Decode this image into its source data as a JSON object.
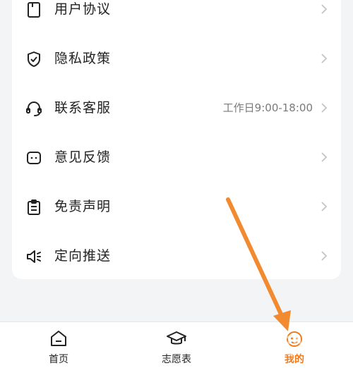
{
  "menu": {
    "items": [
      {
        "label": "用户协议",
        "icon": "document-icon",
        "extra": ""
      },
      {
        "label": "隐私政策",
        "icon": "shield-check-icon",
        "extra": ""
      },
      {
        "label": "联系客服",
        "icon": "headset-icon",
        "extra": "工作日9:00-18:00"
      },
      {
        "label": "意见反馈",
        "icon": "feedback-face-icon",
        "extra": ""
      },
      {
        "label": "免责声明",
        "icon": "clipboard-icon",
        "extra": ""
      },
      {
        "label": "定向推送",
        "icon": "speaker-icon",
        "extra": ""
      }
    ]
  },
  "tabbar": {
    "tabs": [
      {
        "label": "首页",
        "icon": "home-icon",
        "active": false
      },
      {
        "label": "志愿表",
        "icon": "graduation-cap-icon",
        "active": false
      },
      {
        "label": "我的",
        "icon": "profile-mascot-icon",
        "active": true
      }
    ]
  },
  "colors": {
    "accent": "#f07a1e",
    "background": "#f3f4f6",
    "card": "#ffffff",
    "text": "#222222",
    "secondary_text": "#7a7a7a",
    "annotation_arrow": "#f28a30"
  }
}
